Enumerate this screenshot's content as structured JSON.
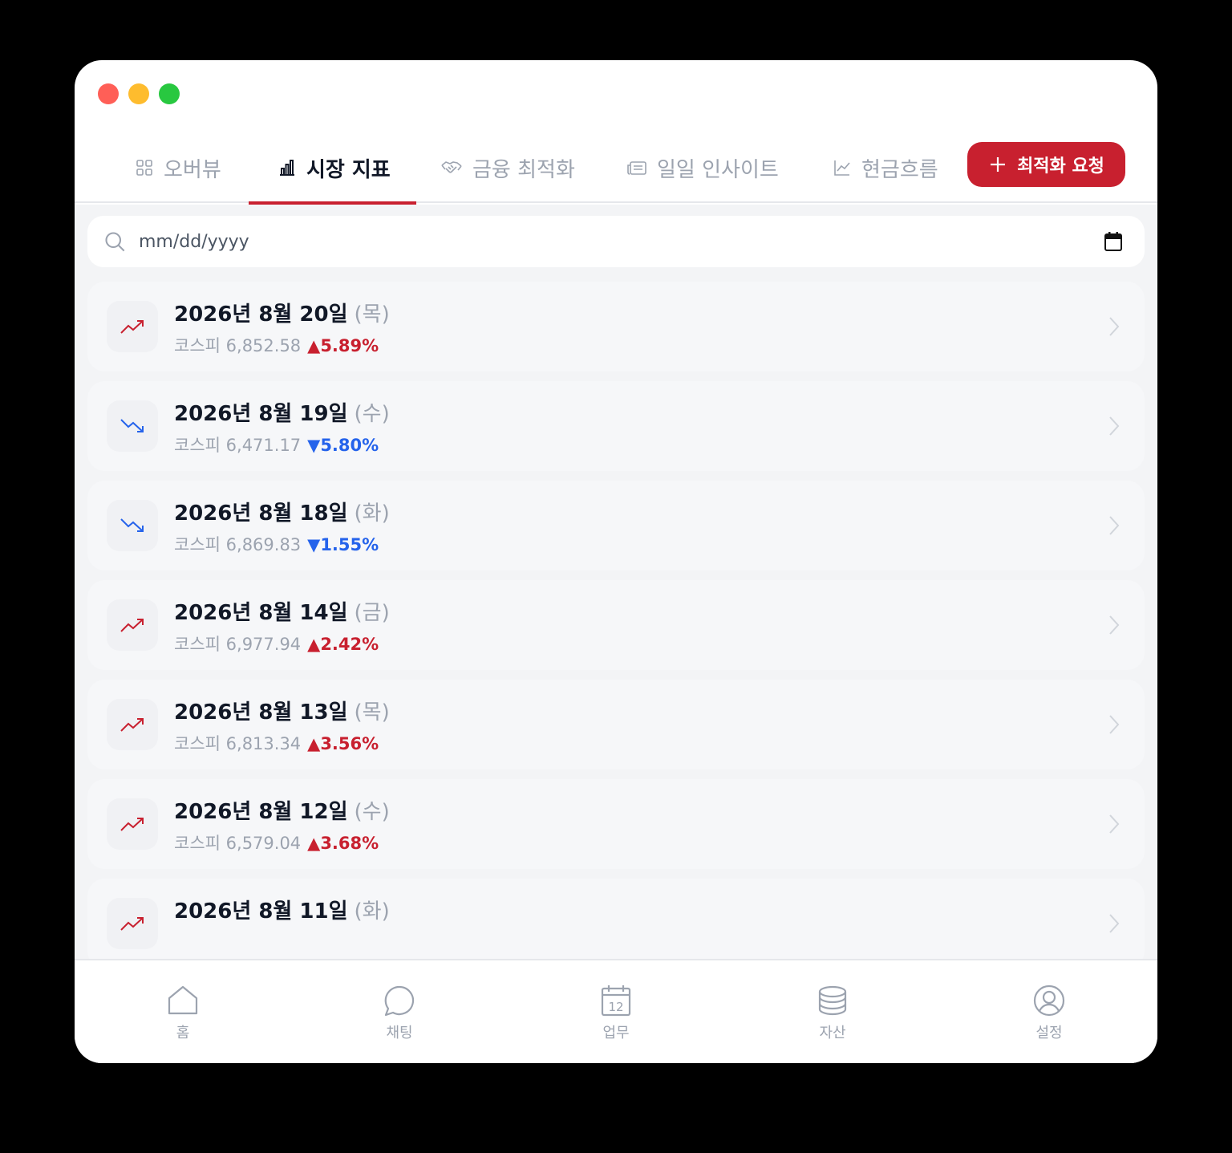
{
  "tabs": [
    {
      "label": "오버뷰",
      "icon": "grid-icon",
      "active": false
    },
    {
      "label": "시장 지표",
      "icon": "bar-chart-icon",
      "active": true
    },
    {
      "label": "금융 최적화",
      "icon": "handshake-icon",
      "active": false
    },
    {
      "label": "일일 인사이트",
      "icon": "newspaper-icon",
      "active": false
    },
    {
      "label": "현금흐름",
      "icon": "line-chart-icon",
      "active": false
    }
  ],
  "cta": {
    "label": "최적화 요청",
    "icon": "plus-icon"
  },
  "search": {
    "placeholder": "mm/dd/yyyy"
  },
  "colors": {
    "accent": "#c8202f",
    "up": "#c8202f",
    "down": "#2563eb"
  },
  "entries": [
    {
      "date": "2026년 8월 20일",
      "weekday": "(목)",
      "index_label": "코스피",
      "value": "6,852.58",
      "change": "▲5.89%",
      "dir": "up"
    },
    {
      "date": "2026년 8월 19일",
      "weekday": "(수)",
      "index_label": "코스피",
      "value": "6,471.17",
      "change": "▼5.80%",
      "dir": "down"
    },
    {
      "date": "2026년 8월 18일",
      "weekday": "(화)",
      "index_label": "코스피",
      "value": "6,869.83",
      "change": "▼1.55%",
      "dir": "down"
    },
    {
      "date": "2026년 8월 14일",
      "weekday": "(금)",
      "index_label": "코스피",
      "value": "6,977.94",
      "change": "▲2.42%",
      "dir": "up"
    },
    {
      "date": "2026년 8월 13일",
      "weekday": "(목)",
      "index_label": "코스피",
      "value": "6,813.34",
      "change": "▲3.56%",
      "dir": "up"
    },
    {
      "date": "2026년 8월 12일",
      "weekday": "(수)",
      "index_label": "코스피",
      "value": "6,579.04",
      "change": "▲3.68%",
      "dir": "up"
    },
    {
      "date": "2026년 8월 11일",
      "weekday": "(화)",
      "index_label": "",
      "value": "",
      "change": "",
      "dir": "up"
    }
  ],
  "nav": [
    {
      "label": "홈",
      "icon": "home-icon"
    },
    {
      "label": "채팅",
      "icon": "chat-icon"
    },
    {
      "label": "업무",
      "icon": "calendar-icon",
      "badge": "12"
    },
    {
      "label": "자산",
      "icon": "database-icon"
    },
    {
      "label": "설정",
      "icon": "user-circle-icon"
    }
  ]
}
